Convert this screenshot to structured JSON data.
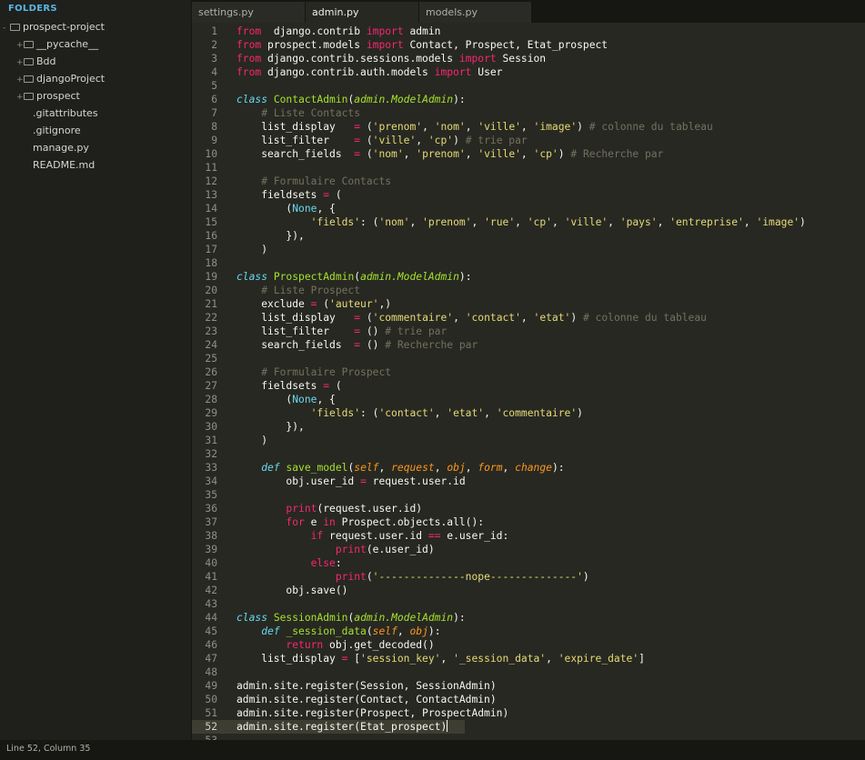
{
  "sidebar": {
    "title": "FOLDERS",
    "items": [
      {
        "label": "prospect-project",
        "type": "folder",
        "expander": "-",
        "depth": 0
      },
      {
        "label": "__pycache__",
        "type": "folder",
        "expander": "+",
        "depth": 1
      },
      {
        "label": "Bdd",
        "type": "folder",
        "expander": "+",
        "depth": 1
      },
      {
        "label": "djangoProject",
        "type": "folder",
        "expander": "+",
        "depth": 1
      },
      {
        "label": "prospect",
        "type": "folder",
        "expander": "+",
        "depth": 1
      },
      {
        "label": ".gitattributes",
        "type": "file",
        "depth": 2
      },
      {
        "label": ".gitignore",
        "type": "file",
        "depth": 2
      },
      {
        "label": "manage.py",
        "type": "file",
        "depth": 2
      },
      {
        "label": "README.md",
        "type": "file",
        "depth": 2
      }
    ]
  },
  "tabs": [
    {
      "label": "settings.py",
      "active": false
    },
    {
      "label": "admin.py",
      "active": true
    },
    {
      "label": "models.py",
      "active": false
    }
  ],
  "editor": {
    "current_line": 52,
    "lines": [
      [
        [
          "k",
          "from"
        ],
        [
          "",
          "  django.contrib "
        ],
        [
          "k",
          "import"
        ],
        [
          "",
          " admin"
        ]
      ],
      [
        [
          "k",
          "from"
        ],
        [
          "",
          " prospect.models "
        ],
        [
          "k",
          "import"
        ],
        [
          "",
          " Contact, Prospect, Etat_prospect"
        ]
      ],
      [
        [
          "k",
          "from"
        ],
        [
          "",
          " django.contrib.sessions.models "
        ],
        [
          "k",
          "import"
        ],
        [
          "",
          " Session"
        ]
      ],
      [
        [
          "k",
          "from"
        ],
        [
          "",
          " django.contrib.auth.models "
        ],
        [
          "k",
          "import"
        ],
        [
          "",
          " User"
        ]
      ],
      [],
      [
        [
          "i",
          "class"
        ],
        [
          "",
          " "
        ],
        [
          "f",
          "ContactAdmin"
        ],
        [
          "",
          "("
        ],
        [
          "inh",
          "admin.ModelAdmin"
        ],
        [
          "",
          "):"
        ]
      ],
      [
        [
          "",
          "    "
        ],
        [
          "c",
          "# Liste Contacts"
        ]
      ],
      [
        [
          "",
          "    list_display   "
        ],
        [
          "k",
          "="
        ],
        [
          "",
          " ("
        ],
        [
          "s",
          "'prenom'"
        ],
        [
          "",
          ", "
        ],
        [
          "s",
          "'nom'"
        ],
        [
          "",
          ", "
        ],
        [
          "s",
          "'ville'"
        ],
        [
          "",
          ", "
        ],
        [
          "s",
          "'image'"
        ],
        [
          "",
          ") "
        ],
        [
          "c",
          "# colonne du tableau"
        ]
      ],
      [
        [
          "",
          "    list_filter    "
        ],
        [
          "k",
          "="
        ],
        [
          "",
          " ("
        ],
        [
          "s",
          "'ville'"
        ],
        [
          "",
          ", "
        ],
        [
          "s",
          "'cp'"
        ],
        [
          "",
          ") "
        ],
        [
          "c",
          "# trie par"
        ]
      ],
      [
        [
          "",
          "    search_fields  "
        ],
        [
          "k",
          "="
        ],
        [
          "",
          " ("
        ],
        [
          "s",
          "'nom'"
        ],
        [
          "",
          ", "
        ],
        [
          "s",
          "'prenom'"
        ],
        [
          "",
          ", "
        ],
        [
          "s",
          "'ville'"
        ],
        [
          "",
          ", "
        ],
        [
          "s",
          "'cp'"
        ],
        [
          "",
          ") "
        ],
        [
          "c",
          "# Recherche par"
        ]
      ],
      [],
      [
        [
          "",
          "    "
        ],
        [
          "c",
          "# Formulaire Contacts"
        ]
      ],
      [
        [
          "",
          "    fieldsets "
        ],
        [
          "k",
          "="
        ],
        [
          "",
          " ("
        ]
      ],
      [
        [
          "",
          "        ("
        ],
        [
          "b",
          "None"
        ],
        [
          "",
          ", {"
        ]
      ],
      [
        [
          "",
          "            "
        ],
        [
          "s",
          "'fields'"
        ],
        [
          "",
          ": ("
        ],
        [
          "s",
          "'nom'"
        ],
        [
          "",
          ", "
        ],
        [
          "s",
          "'prenom'"
        ],
        [
          "",
          ", "
        ],
        [
          "s",
          "'rue'"
        ],
        [
          "",
          ", "
        ],
        [
          "s",
          "'cp'"
        ],
        [
          "",
          ", "
        ],
        [
          "s",
          "'ville'"
        ],
        [
          "",
          ", "
        ],
        [
          "s",
          "'pays'"
        ],
        [
          "",
          ", "
        ],
        [
          "s",
          "'entreprise'"
        ],
        [
          "",
          ", "
        ],
        [
          "s",
          "'image'"
        ],
        [
          "",
          ")"
        ]
      ],
      [
        [
          "",
          "        }),"
        ]
      ],
      [
        [
          "",
          "    )"
        ]
      ],
      [],
      [
        [
          "i",
          "class"
        ],
        [
          "",
          " "
        ],
        [
          "f",
          "ProspectAdmin"
        ],
        [
          "",
          "("
        ],
        [
          "inh",
          "admin.ModelAdmin"
        ],
        [
          "",
          "):"
        ]
      ],
      [
        [
          "",
          "    "
        ],
        [
          "c",
          "# Liste Prospect"
        ]
      ],
      [
        [
          "",
          "    exclude "
        ],
        [
          "k",
          "="
        ],
        [
          "",
          " ("
        ],
        [
          "s",
          "'auteur'"
        ],
        [
          "",
          ",)"
        ]
      ],
      [
        [
          "",
          "    list_display   "
        ],
        [
          "k",
          "="
        ],
        [
          "",
          " ("
        ],
        [
          "s",
          "'commentaire'"
        ],
        [
          "",
          ", "
        ],
        [
          "s",
          "'contact'"
        ],
        [
          "",
          ", "
        ],
        [
          "s",
          "'etat'"
        ],
        [
          "",
          ") "
        ],
        [
          "c",
          "# colonne du tableau"
        ]
      ],
      [
        [
          "",
          "    list_filter    "
        ],
        [
          "k",
          "="
        ],
        [
          "",
          " () "
        ],
        [
          "c",
          "# trie par"
        ]
      ],
      [
        [
          "",
          "    search_fields  "
        ],
        [
          "k",
          "="
        ],
        [
          "",
          " () "
        ],
        [
          "c",
          "# Recherche par"
        ]
      ],
      [],
      [
        [
          "",
          "    "
        ],
        [
          "c",
          "# Formulaire Prospect"
        ]
      ],
      [
        [
          "",
          "    fieldsets "
        ],
        [
          "k",
          "="
        ],
        [
          "",
          " ("
        ]
      ],
      [
        [
          "",
          "        ("
        ],
        [
          "b",
          "None"
        ],
        [
          "",
          ", {"
        ]
      ],
      [
        [
          "",
          "            "
        ],
        [
          "s",
          "'fields'"
        ],
        [
          "",
          ": ("
        ],
        [
          "s",
          "'contact'"
        ],
        [
          "",
          ", "
        ],
        [
          "s",
          "'etat'"
        ],
        [
          "",
          ", "
        ],
        [
          "s",
          "'commentaire'"
        ],
        [
          "",
          ")"
        ]
      ],
      [
        [
          "",
          "        }),"
        ]
      ],
      [
        [
          "",
          "    )"
        ]
      ],
      [],
      [
        [
          "",
          "    "
        ],
        [
          "i",
          "def"
        ],
        [
          "",
          " "
        ],
        [
          "f",
          "save_model"
        ],
        [
          "",
          "("
        ],
        [
          "p",
          "self"
        ],
        [
          "",
          ", "
        ],
        [
          "p",
          "request"
        ],
        [
          "",
          ", "
        ],
        [
          "p",
          "obj"
        ],
        [
          "",
          ", "
        ],
        [
          "p",
          "form"
        ],
        [
          "",
          ", "
        ],
        [
          "p",
          "change"
        ],
        [
          "",
          "):"
        ]
      ],
      [
        [
          "",
          "        obj.user_id "
        ],
        [
          "k",
          "="
        ],
        [
          "",
          " request.user.id"
        ]
      ],
      [],
      [
        [
          "",
          "        "
        ],
        [
          "k",
          "print"
        ],
        [
          "",
          "(request.user.id)"
        ]
      ],
      [
        [
          "",
          "        "
        ],
        [
          "k",
          "for"
        ],
        [
          "",
          " e "
        ],
        [
          "k",
          "in"
        ],
        [
          "",
          " Prospect.objects.all():"
        ]
      ],
      [
        [
          "",
          "            "
        ],
        [
          "k",
          "if"
        ],
        [
          "",
          " request.user.id "
        ],
        [
          "k",
          "=="
        ],
        [
          "",
          " e.user_id:"
        ]
      ],
      [
        [
          "",
          "                "
        ],
        [
          "k",
          "print"
        ],
        [
          "",
          "(e.user_id)"
        ]
      ],
      [
        [
          "",
          "            "
        ],
        [
          "k",
          "else"
        ],
        [
          "",
          ":"
        ]
      ],
      [
        [
          "",
          "                "
        ],
        [
          "k",
          "print"
        ],
        [
          "",
          "("
        ],
        [
          "s",
          "'--------------nope--------------'"
        ],
        [
          "",
          ")"
        ]
      ],
      [
        [
          "",
          "        obj.save()"
        ]
      ],
      [],
      [
        [
          "i",
          "class"
        ],
        [
          "",
          " "
        ],
        [
          "f",
          "SessionAdmin"
        ],
        [
          "",
          "("
        ],
        [
          "inh",
          "admin.ModelAdmin"
        ],
        [
          "",
          "):"
        ]
      ],
      [
        [
          "",
          "    "
        ],
        [
          "i",
          "def"
        ],
        [
          "",
          " "
        ],
        [
          "f",
          "_session_data"
        ],
        [
          "",
          "("
        ],
        [
          "p",
          "self"
        ],
        [
          "",
          ", "
        ],
        [
          "p",
          "obj"
        ],
        [
          "",
          "):"
        ]
      ],
      [
        [
          "",
          "        "
        ],
        [
          "k",
          "return"
        ],
        [
          "",
          " obj.get_decoded()"
        ]
      ],
      [
        [
          "",
          "    list_display "
        ],
        [
          "k",
          "="
        ],
        [
          "",
          " ["
        ],
        [
          "s",
          "'session_key'"
        ],
        [
          "",
          ", "
        ],
        [
          "s",
          "'_session_data'"
        ],
        [
          "",
          ", "
        ],
        [
          "s",
          "'expire_date'"
        ],
        [
          "",
          "]"
        ]
      ],
      [],
      [
        [
          "",
          "admin.site.register(Session, SessionAdmin)"
        ]
      ],
      [
        [
          "",
          "admin.site.register(Contact, ContactAdmin)"
        ]
      ],
      [
        [
          "",
          "admin.site.register(Prospect, ProspectAdmin)"
        ]
      ],
      [
        [
          "",
          "admin.site.register(Etat_prospect)"
        ]
      ],
      []
    ]
  },
  "status": {
    "text": "Line 52, Column 35"
  },
  "colors": {
    "keyword": "#f92672",
    "string": "#e6db74",
    "comment": "#75715e",
    "function": "#a6e22e",
    "storage": "#66d9ef",
    "param": "#fd971f",
    "background": "#272822"
  }
}
